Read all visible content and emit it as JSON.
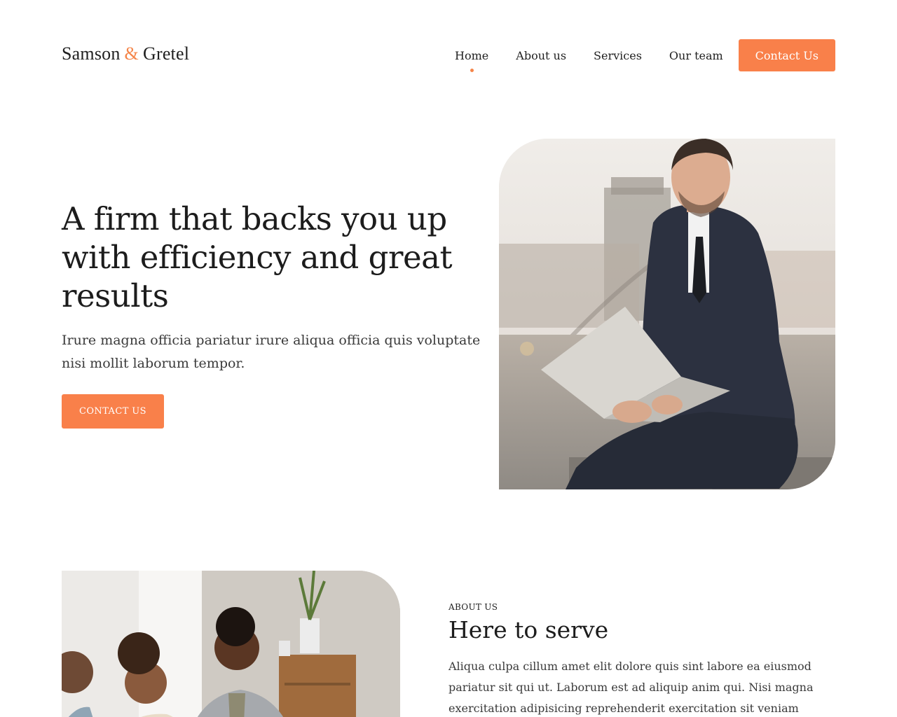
{
  "header": {
    "logo": {
      "first": "Samson",
      "amp": "&",
      "second": "Gretel"
    },
    "nav": [
      {
        "label": "Home",
        "active": true
      },
      {
        "label": "About us",
        "active": false
      },
      {
        "label": "Services",
        "active": false
      },
      {
        "label": "Our team",
        "active": false
      }
    ],
    "cta_label": "Contact Us"
  },
  "hero": {
    "title": "A firm that backs you up with efficiency and great results",
    "subtitle": "Irure magna officia pariatur irure aliqua officia quis voluptate nisi mollit laborum tempor.",
    "button_label": "CONTACT US"
  },
  "about": {
    "eyebrow": "ABOUT US",
    "title": "Here to serve",
    "text": "Aliqua culpa cillum amet elit dolore quis sint labore ea eiusmod pariatur sit qui ut. Laborum est ad aliquip anim qui. Nisi magna exercitation adipisicing reprehenderit exercitation sit veniam deserunt eiusmod amet"
  },
  "colors": {
    "accent": "#f9804a",
    "text": "#1f1f1f",
    "background": "#ffffff"
  }
}
